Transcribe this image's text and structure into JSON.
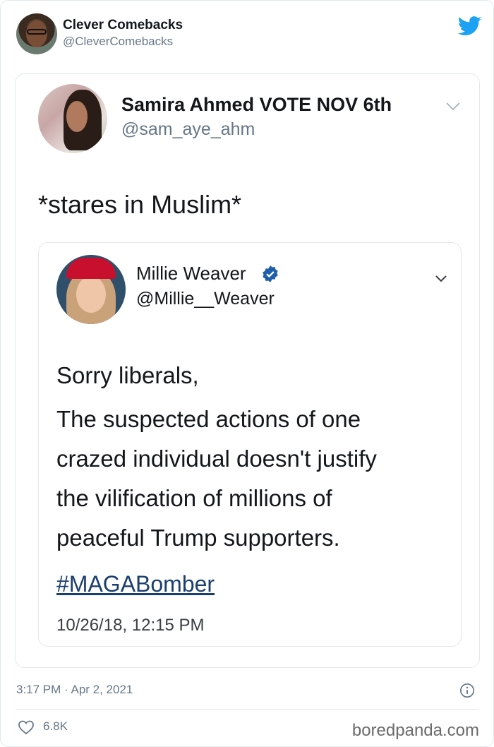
{
  "outer_tweet": {
    "author_name": "Clever Comebacks",
    "author_handle": "@CleverComebacks",
    "timestamp": "3:17 PM · Apr 2, 2021",
    "likes": "6.8K",
    "brand_color": "#1da1f2"
  },
  "screenshot_tweet": {
    "author_name": "Samira Ahmed VOTE NOV 6th",
    "author_handle": "@sam_aye_ahm",
    "text": "*stares in Muslim*"
  },
  "quoted_tweet": {
    "author_name": "Millie Weaver",
    "author_handle": "@Millie__Weaver",
    "verified": true,
    "lines": [
      "Sorry liberals,",
      "The suspected actions of one",
      "crazed individual doesn't justify",
      "the vilification of millions of",
      "peaceful Trump supporters."
    ],
    "hashtag": "#MAGABomber",
    "timestamp": "10/26/18, 12:15 PM"
  },
  "watermark": "boredpanda.com",
  "icons": {
    "brand": "twitter-bird-icon",
    "menu": "chevron-down-icon",
    "verified": "verified-badge-icon",
    "info": "info-icon",
    "like": "heart-icon"
  }
}
